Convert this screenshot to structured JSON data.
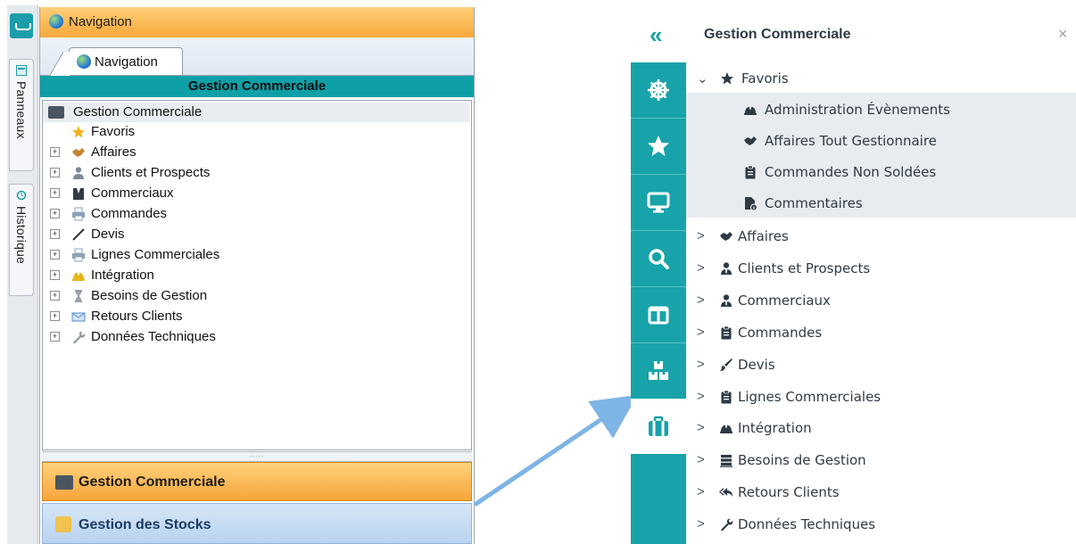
{
  "old_ui": {
    "side_tabs": [
      "Panneaux",
      "Historique"
    ],
    "header_title": "Navigation",
    "tab_label": "Navigation",
    "section_bar": "Gestion Commerciale",
    "tree_root": "Gestion Commerciale",
    "tree_items": [
      {
        "label": "Favoris",
        "icon": "star-icon"
      },
      {
        "label": "Affaires",
        "icon": "handshake-icon"
      },
      {
        "label": "Clients et Prospects",
        "icon": "person-icon"
      },
      {
        "label": "Commerciaux",
        "icon": "suit-icon"
      },
      {
        "label": "Commandes",
        "icon": "printer-icon"
      },
      {
        "label": "Devis",
        "icon": "pen-icon"
      },
      {
        "label": "Lignes Commerciales",
        "icon": "printer-icon"
      },
      {
        "label": "Intégration",
        "icon": "hardhat-icon"
      },
      {
        "label": "Besoins de Gestion",
        "icon": "hourglass-icon"
      },
      {
        "label": "Retours Clients",
        "icon": "envelope-icon"
      },
      {
        "label": "Données Techniques",
        "icon": "wrench-icon"
      }
    ],
    "bottom_buttons": [
      "Gestion Commerciale",
      "Gestion des Stocks"
    ]
  },
  "new_ui": {
    "collapse_icon": "«",
    "title": "Gestion Commerciale",
    "close_icon": "×",
    "sidebar_icons": [
      "helm-icon",
      "star-icon",
      "monitor-icon",
      "search-icon",
      "columns-icon",
      "boxes-icon",
      "briefcase-icon"
    ],
    "favoris": {
      "label": "Favoris",
      "caret": "⌄",
      "children": [
        {
          "label": "Administration Évènements",
          "icon": "hardhat-icon"
        },
        {
          "label": "Affaires Tout Gestionnaire",
          "icon": "handshake-icon"
        },
        {
          "label": "Commandes Non Soldées",
          "icon": "clipboard-icon"
        },
        {
          "label": "Commentaires",
          "icon": "file-info-icon"
        }
      ]
    },
    "items": [
      {
        "label": "Affaires",
        "icon": "handshake-icon"
      },
      {
        "label": "Clients et Prospects",
        "icon": "user-tie-icon"
      },
      {
        "label": "Commerciaux",
        "icon": "user-tie-icon"
      },
      {
        "label": "Commandes",
        "icon": "clipboard-icon"
      },
      {
        "label": "Devis",
        "icon": "brush-icon"
      },
      {
        "label": "Lignes Commerciales",
        "icon": "clipboard-icon"
      },
      {
        "label": "Intégration",
        "icon": "hardhat-icon"
      },
      {
        "label": "Besoins de Gestion",
        "icon": "server-icon"
      },
      {
        "label": "Retours Clients",
        "icon": "reply-all-icon"
      },
      {
        "label": "Données Techniques",
        "icon": "wrench-icon"
      }
    ],
    "caret": ">"
  },
  "colors": {
    "teal": "#17a3a9",
    "orange": "#f6a43a",
    "arrow": "#7fb4e6"
  }
}
